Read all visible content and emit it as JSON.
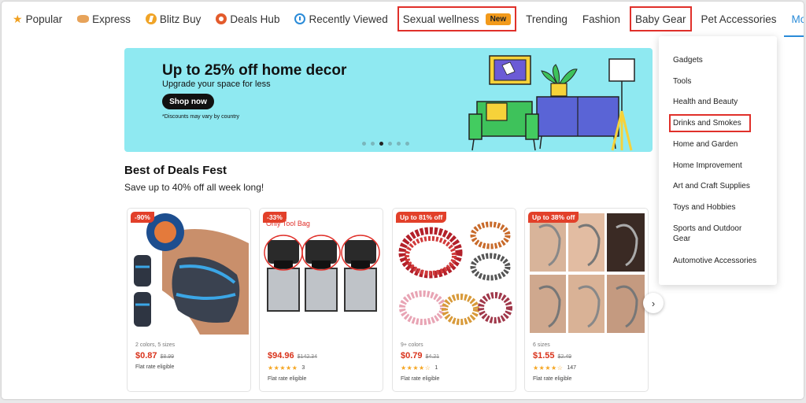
{
  "nav": {
    "items": [
      {
        "label": "Popular",
        "icon": "star-icon"
      },
      {
        "label": "Express",
        "icon": "express-icon"
      },
      {
        "label": "Blitz Buy",
        "icon": "blitz-icon"
      },
      {
        "label": "Deals Hub",
        "icon": "deals-icon"
      },
      {
        "label": "Recently Viewed",
        "icon": "clock-icon"
      },
      {
        "label": "Sexual wellness",
        "badge": "New"
      },
      {
        "label": "Trending"
      },
      {
        "label": "Fashion"
      },
      {
        "label": "Baby Gear"
      },
      {
        "label": "Pet Accessories"
      },
      {
        "label": "More"
      }
    ]
  },
  "banner": {
    "title": "Up to 25% off home decor",
    "subtitle": "Upgrade your space for less",
    "button": "Shop now",
    "note": "*Discounts may vary by country"
  },
  "section": {
    "title": "Best of Deals Fest",
    "subtitle": "Save up to 40% off all week long!"
  },
  "products": [
    {
      "discount": "-90%",
      "meta": "2 colors, 5 sizes",
      "price": "$0.87",
      "old": "$8.99",
      "flat": "Flat rate eligible"
    },
    {
      "discount": "-33%",
      "overlay": "Only Tool Bag",
      "price": "$94.96",
      "old": "$142.34",
      "stars": "★★★★★",
      "reviews": "3",
      "flat": "Flat rate eligible"
    },
    {
      "discount": "Up to 81% off",
      "meta": "9+ colors",
      "price": "$0.79",
      "old": "$4.21",
      "stars": "★★★★☆",
      "reviews": "1",
      "flat": "Flat rate eligible"
    },
    {
      "discount": "Up to 38% off",
      "meta": "6 sizes",
      "price": "$1.55",
      "old": "$2.49",
      "stars": "★★★★☆",
      "reviews": "147",
      "flat": "Flat rate eligible"
    }
  ],
  "more_menu": {
    "items": [
      "Gadgets",
      "Tools",
      "Health and Beauty",
      "Drinks and Smokes",
      "Home and Garden",
      "Home Improvement",
      "Art and Craft Supplies",
      "Toys and Hobbies",
      "Sports and Outdoor Gear",
      "Automotive Accessories"
    ]
  },
  "colors": {
    "accent": "#2a8bd8",
    "price": "#d9331b",
    "badge": "#f29a1b",
    "banner": "#8fe9f1",
    "highlight": "#e0302a"
  }
}
